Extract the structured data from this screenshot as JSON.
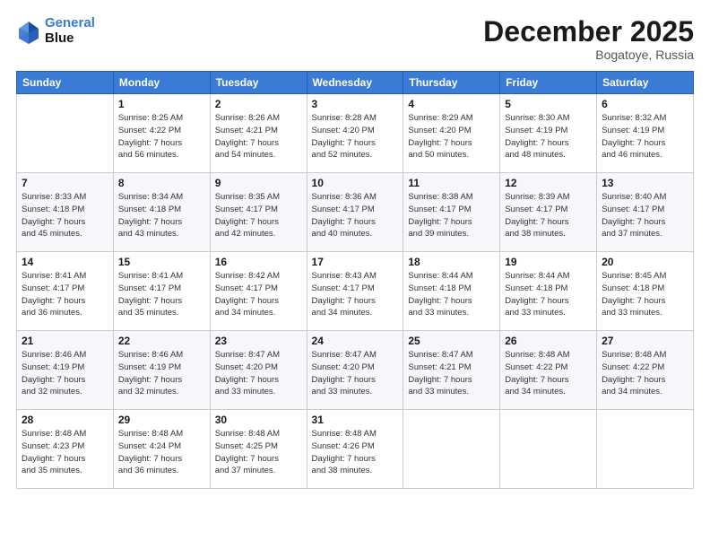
{
  "header": {
    "logo_line1": "General",
    "logo_line2": "Blue",
    "month": "December 2025",
    "location": "Bogatoye, Russia"
  },
  "days_of_week": [
    "Sunday",
    "Monday",
    "Tuesday",
    "Wednesday",
    "Thursday",
    "Friday",
    "Saturday"
  ],
  "weeks": [
    [
      {
        "day": "",
        "info": ""
      },
      {
        "day": "1",
        "info": "Sunrise: 8:25 AM\nSunset: 4:22 PM\nDaylight: 7 hours\nand 56 minutes."
      },
      {
        "day": "2",
        "info": "Sunrise: 8:26 AM\nSunset: 4:21 PM\nDaylight: 7 hours\nand 54 minutes."
      },
      {
        "day": "3",
        "info": "Sunrise: 8:28 AM\nSunset: 4:20 PM\nDaylight: 7 hours\nand 52 minutes."
      },
      {
        "day": "4",
        "info": "Sunrise: 8:29 AM\nSunset: 4:20 PM\nDaylight: 7 hours\nand 50 minutes."
      },
      {
        "day": "5",
        "info": "Sunrise: 8:30 AM\nSunset: 4:19 PM\nDaylight: 7 hours\nand 48 minutes."
      },
      {
        "day": "6",
        "info": "Sunrise: 8:32 AM\nSunset: 4:19 PM\nDaylight: 7 hours\nand 46 minutes."
      }
    ],
    [
      {
        "day": "7",
        "info": "Sunrise: 8:33 AM\nSunset: 4:18 PM\nDaylight: 7 hours\nand 45 minutes."
      },
      {
        "day": "8",
        "info": "Sunrise: 8:34 AM\nSunset: 4:18 PM\nDaylight: 7 hours\nand 43 minutes."
      },
      {
        "day": "9",
        "info": "Sunrise: 8:35 AM\nSunset: 4:17 PM\nDaylight: 7 hours\nand 42 minutes."
      },
      {
        "day": "10",
        "info": "Sunrise: 8:36 AM\nSunset: 4:17 PM\nDaylight: 7 hours\nand 40 minutes."
      },
      {
        "day": "11",
        "info": "Sunrise: 8:38 AM\nSunset: 4:17 PM\nDaylight: 7 hours\nand 39 minutes."
      },
      {
        "day": "12",
        "info": "Sunrise: 8:39 AM\nSunset: 4:17 PM\nDaylight: 7 hours\nand 38 minutes."
      },
      {
        "day": "13",
        "info": "Sunrise: 8:40 AM\nSunset: 4:17 PM\nDaylight: 7 hours\nand 37 minutes."
      }
    ],
    [
      {
        "day": "14",
        "info": "Sunrise: 8:41 AM\nSunset: 4:17 PM\nDaylight: 7 hours\nand 36 minutes."
      },
      {
        "day": "15",
        "info": "Sunrise: 8:41 AM\nSunset: 4:17 PM\nDaylight: 7 hours\nand 35 minutes."
      },
      {
        "day": "16",
        "info": "Sunrise: 8:42 AM\nSunset: 4:17 PM\nDaylight: 7 hours\nand 34 minutes."
      },
      {
        "day": "17",
        "info": "Sunrise: 8:43 AM\nSunset: 4:17 PM\nDaylight: 7 hours\nand 34 minutes."
      },
      {
        "day": "18",
        "info": "Sunrise: 8:44 AM\nSunset: 4:18 PM\nDaylight: 7 hours\nand 33 minutes."
      },
      {
        "day": "19",
        "info": "Sunrise: 8:44 AM\nSunset: 4:18 PM\nDaylight: 7 hours\nand 33 minutes."
      },
      {
        "day": "20",
        "info": "Sunrise: 8:45 AM\nSunset: 4:18 PM\nDaylight: 7 hours\nand 33 minutes."
      }
    ],
    [
      {
        "day": "21",
        "info": "Sunrise: 8:46 AM\nSunset: 4:19 PM\nDaylight: 7 hours\nand 32 minutes."
      },
      {
        "day": "22",
        "info": "Sunrise: 8:46 AM\nSunset: 4:19 PM\nDaylight: 7 hours\nand 32 minutes."
      },
      {
        "day": "23",
        "info": "Sunrise: 8:47 AM\nSunset: 4:20 PM\nDaylight: 7 hours\nand 33 minutes."
      },
      {
        "day": "24",
        "info": "Sunrise: 8:47 AM\nSunset: 4:20 PM\nDaylight: 7 hours\nand 33 minutes."
      },
      {
        "day": "25",
        "info": "Sunrise: 8:47 AM\nSunset: 4:21 PM\nDaylight: 7 hours\nand 33 minutes."
      },
      {
        "day": "26",
        "info": "Sunrise: 8:48 AM\nSunset: 4:22 PM\nDaylight: 7 hours\nand 34 minutes."
      },
      {
        "day": "27",
        "info": "Sunrise: 8:48 AM\nSunset: 4:22 PM\nDaylight: 7 hours\nand 34 minutes."
      }
    ],
    [
      {
        "day": "28",
        "info": "Sunrise: 8:48 AM\nSunset: 4:23 PM\nDaylight: 7 hours\nand 35 minutes."
      },
      {
        "day": "29",
        "info": "Sunrise: 8:48 AM\nSunset: 4:24 PM\nDaylight: 7 hours\nand 36 minutes."
      },
      {
        "day": "30",
        "info": "Sunrise: 8:48 AM\nSunset: 4:25 PM\nDaylight: 7 hours\nand 37 minutes."
      },
      {
        "day": "31",
        "info": "Sunrise: 8:48 AM\nSunset: 4:26 PM\nDaylight: 7 hours\nand 38 minutes."
      },
      {
        "day": "",
        "info": ""
      },
      {
        "day": "",
        "info": ""
      },
      {
        "day": "",
        "info": ""
      }
    ]
  ]
}
